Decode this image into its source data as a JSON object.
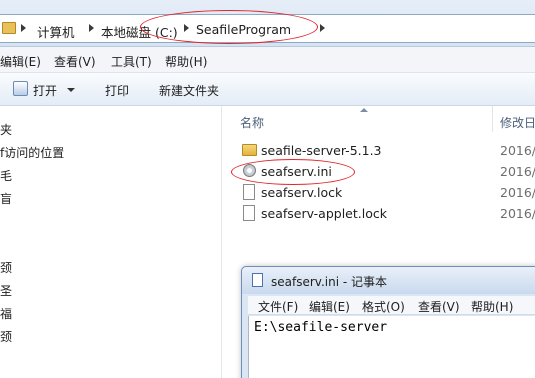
{
  "address": {
    "crumbs": [
      "计算机",
      "本地磁盘 (C:)",
      "SeafileProgram"
    ]
  },
  "menu": [
    "编辑(E)",
    "查看(V)",
    "工具(T)",
    "帮助(H)"
  ],
  "toolbar": {
    "open": "打开",
    "print": "打印",
    "new_folder": "新建文件夹"
  },
  "nav": {
    "items": [
      "夹",
      "f访问的位置",
      "毛",
      "盲",
      "颈",
      "圣",
      "福",
      "颈"
    ]
  },
  "filelist": {
    "col_name": "名称",
    "col_modified": "修改日",
    "rows": [
      {
        "name": "seafile-server-5.1.3",
        "date": "2016/",
        "type": "folder-icon"
      },
      {
        "name": "seafserv.ini",
        "date": "2016/",
        "type": "settings-file-icon"
      },
      {
        "name": "seafserv.lock",
        "date": "2016/",
        "type": "document-icon"
      },
      {
        "name": "seafserv-applet.lock",
        "date": "2016/",
        "type": "document-icon"
      }
    ]
  },
  "notepad": {
    "title": "seafserv.ini - 记事本",
    "menu": [
      "文件(F)",
      "编辑(E)",
      "格式(O)",
      "查看(V)",
      "帮助(H)"
    ],
    "content": "E:\\seafile-server"
  },
  "colors": {
    "highlight_oval": "#e0262b"
  }
}
